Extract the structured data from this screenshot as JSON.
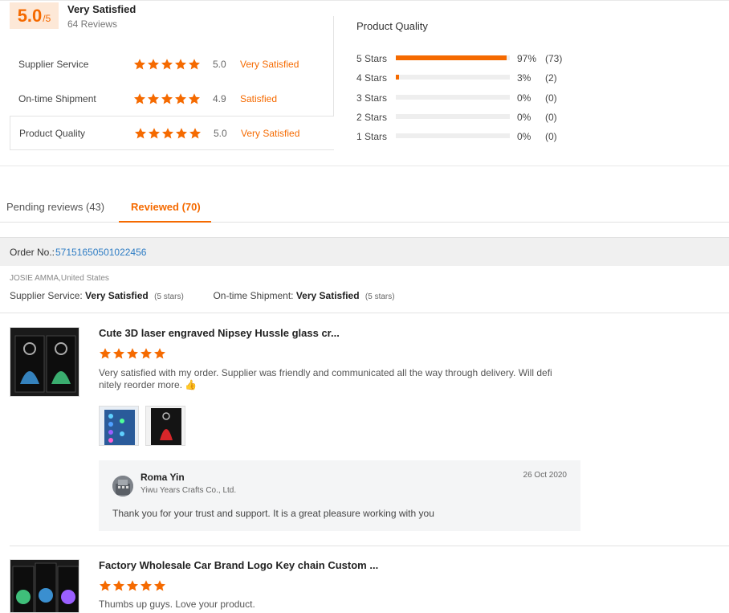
{
  "summary": {
    "score": "5.0",
    "score_max": "/5",
    "label": "Very Satisfied",
    "reviews_count": "64 Reviews",
    "ratings": [
      {
        "name": "Supplier Service",
        "score": "5.0",
        "label": "Very Satisfied",
        "stars": 5
      },
      {
        "name": "On-time Shipment",
        "score": "4.9",
        "label": "Satisfied",
        "stars": 5
      },
      {
        "name": "Product Quality",
        "score": "5.0",
        "label": "Very Satisfied",
        "stars": 5
      }
    ]
  },
  "histogram": {
    "title": "Product Quality",
    "rows": [
      {
        "label": "5 Stars",
        "fraction": 0.97,
        "pct": "97%",
        "count": "(73)"
      },
      {
        "label": "4 Stars",
        "fraction": 0.03,
        "pct": "3%",
        "count": "(2)"
      },
      {
        "label": "3 Stars",
        "fraction": 0,
        "pct": "0%",
        "count": "(0)"
      },
      {
        "label": "2 Stars",
        "fraction": 0,
        "pct": "0%",
        "count": "(0)"
      },
      {
        "label": "1 Stars",
        "fraction": 0,
        "pct": "0%",
        "count": "(0)"
      }
    ]
  },
  "tabs": {
    "pending": "Pending reviews (43)",
    "reviewed": "Reviewed (70)"
  },
  "order": {
    "label": "Order No.: ",
    "number": "57151650501022456",
    "buyer": "JOSIE AMMA,United States",
    "supplier_service_label": "Supplier Service: ",
    "supplier_service_value": "Very Satisfied",
    "supplier_service_stars": "(5 stars)",
    "shipment_label": "On-time Shipment: ",
    "shipment_value": "Very Satisfied",
    "shipment_stars": "(5 stars)"
  },
  "reviews": [
    {
      "title": "Cute 3D laser engraved Nipsey Hussle glass cr...",
      "stars": 5,
      "text_line1": "Very satisfied with my  order. Supplier was friendly and communicated all the way through delivery. Will defi",
      "text_line2": "nitely reorder more. 👍",
      "reply": {
        "name": "Roma Yin",
        "company": "Yiwu Years Crafts Co., Ltd.",
        "date": "26 Oct 2020",
        "text": "Thank you for your trust and support. It is a great pleasure working with you"
      }
    },
    {
      "title": "Factory Wholesale Car Brand Logo Key chain Custom ...",
      "stars": 5,
      "text_line1": "Thumbs up guys. Love your product."
    }
  ],
  "colors": {
    "accent": "#f56a00",
    "link": "#2d7cc4"
  },
  "icons": {
    "star": "star-icon",
    "thumbs_up": "thumbs-up-icon",
    "avatar": "avatar"
  }
}
